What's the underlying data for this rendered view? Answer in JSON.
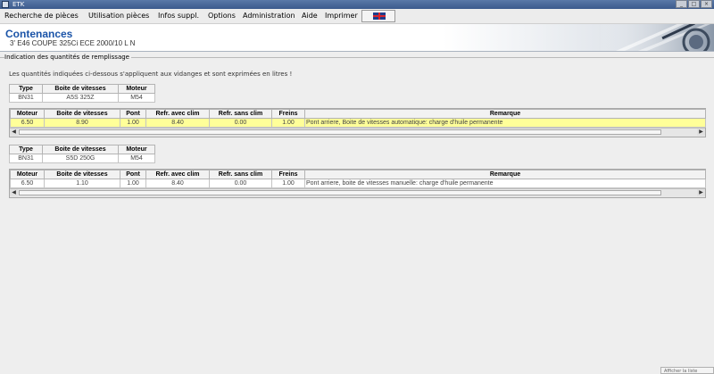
{
  "window": {
    "title": "ETK"
  },
  "menu": [
    "Recherche de pièces",
    "Utilisation pièces",
    "Infos suppl.",
    "Options",
    "Administration",
    "Aide",
    "Imprimer"
  ],
  "header": {
    "title": "Contenances",
    "subtitle": "3' E46 COUPE 325Ci ECE 2000/10 L N"
  },
  "section": {
    "label": "Indication des quantités de remplissage",
    "note": "Les quantités indiquées ci-dessous s'appliquent aux vidanges et sont exprimées en litres !"
  },
  "group1": {
    "spec_headers": [
      "Type",
      "Boite de vitesses",
      "Moteur"
    ],
    "spec_values": [
      "BN31",
      "A5S 325Z",
      "M54"
    ],
    "headers": [
      "Moteur",
      "Boite de vitesses",
      "Pont",
      "Refr. avec clim",
      "Refr. sans clim",
      "Freins",
      "Remarque"
    ],
    "row": [
      "6.50",
      "8.90",
      "1.00",
      "8.40",
      "0.00",
      "1.00",
      "Pont arriere, Boite de vitesses automatique: charge d'huile permanente"
    ]
  },
  "group2": {
    "spec_headers": [
      "Type",
      "Boite de vitesses",
      "Moteur"
    ],
    "spec_values": [
      "BN31",
      "S5D 250G",
      "M54"
    ],
    "headers": [
      "Moteur",
      "Boite de vitesses",
      "Pont",
      "Refr. avec clim",
      "Refr. sans clim",
      "Freins",
      "Remarque"
    ],
    "row": [
      "6.50",
      "1.10",
      "1.00",
      "8.40",
      "0.00",
      "1.00",
      "Pont arriere, boite de vitesses manuelle: charge d'huile permanente"
    ]
  },
  "footer": {
    "tab": "Afficher la liste"
  },
  "colors": {
    "selected_row": "#ffff99",
    "header_title": "#1b54a8",
    "titlebar": "#3b5a8c"
  },
  "icons": {
    "flag": "uk-flag-icon",
    "scroll_left": "arrow-left-icon",
    "scroll_right": "arrow-right-icon"
  }
}
